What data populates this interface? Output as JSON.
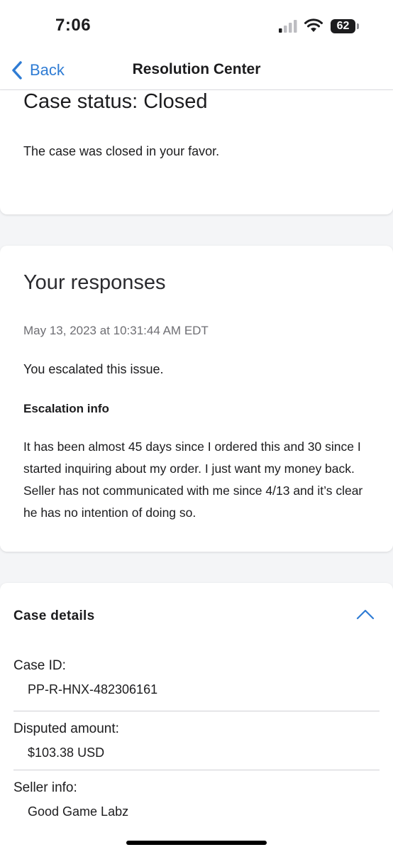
{
  "status_bar": {
    "time": "7:06",
    "battery": "62"
  },
  "nav": {
    "back_label": "Back",
    "title": "Resolution Center"
  },
  "status_card": {
    "heading": "Case status: Closed",
    "message": "The case was closed in your favor."
  },
  "responses_card": {
    "heading": "Your responses",
    "timestamp": "May 13, 2023 at 10:31:44 AM EDT",
    "action": "You escalated this issue.",
    "escalation_heading": "Escalation info",
    "escalation_text": "It has been almost 45 days since I ordered this and 30 since I started inquiring about my order. I just want my money back. Seller has not communicated with me since 4/13 and it’s clear he has no intention of doing so."
  },
  "details_card": {
    "heading": "Case details",
    "rows": [
      {
        "label": "Case ID:",
        "value": "PP-R-HNX-482306161"
      },
      {
        "label": "Disputed amount:",
        "value": "$103.38 USD"
      },
      {
        "label": "Seller info:",
        "value": "Good Game Labz"
      }
    ]
  },
  "colors": {
    "accent": "#2f7cd4",
    "background": "#f4f5f7",
    "card": "#ffffff"
  }
}
